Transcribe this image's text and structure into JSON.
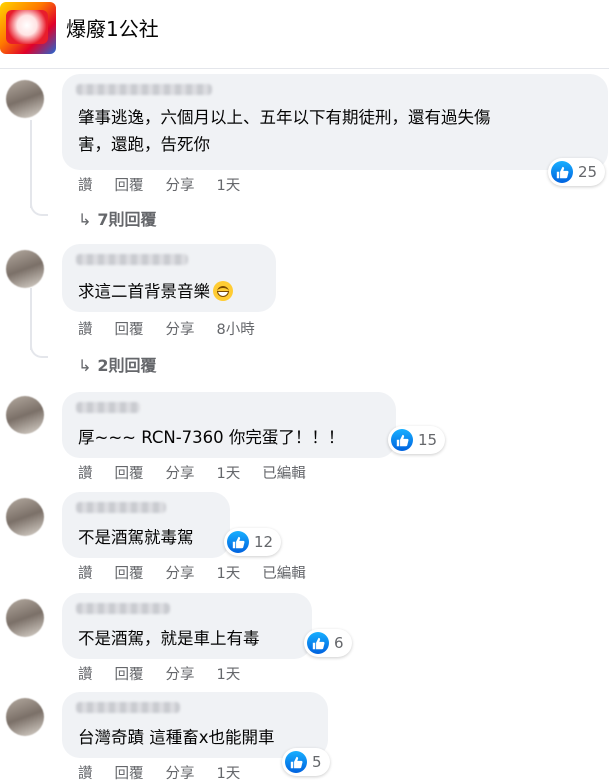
{
  "header": {
    "title": "爆廢1公社"
  },
  "actions": {
    "like": "讚",
    "reply": "回覆",
    "share": "分享"
  },
  "comments": [
    {
      "text": "肇事逃逸，六個月以上、五年以下有期徒刑，還有過失傷\n害，還跑，告死你",
      "reactions": "25",
      "time": "1天",
      "edited": "",
      "replies": "7則回覆"
    },
    {
      "text": "求這二首背景音樂",
      "emoji": "grinning-face-emoji",
      "reactions": "",
      "time": "8小時",
      "edited": "",
      "replies": "2則回覆"
    },
    {
      "text": "厚~~~ RCN-7360 你完蛋了！！！",
      "reactions": "15",
      "time": "1天",
      "edited": "已編輯",
      "replies": ""
    },
    {
      "text": "不是酒駕就毒駕",
      "reactions": "12",
      "time": "1天",
      "edited": "已編輯",
      "replies": ""
    },
    {
      "text": "不是酒駕，就是車上有毒",
      "reactions": "6",
      "time": "1天",
      "edited": "",
      "replies": ""
    },
    {
      "text": "台灣奇蹟 這種畜x也能開車",
      "reactions": "5",
      "time": "1天",
      "edited": "",
      "replies": ""
    }
  ],
  "colors": {
    "like_blue": "#1877f2",
    "bubble": "#f0f2f5",
    "meta_text": "#65676b"
  }
}
